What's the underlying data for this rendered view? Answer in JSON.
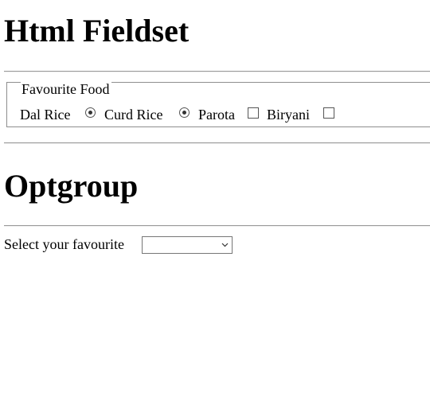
{
  "section_fieldset": {
    "heading": "Html Fieldset",
    "legend": "Favourite Food",
    "options": [
      {
        "label": "Dal Rice",
        "control": "radio",
        "checked": true
      },
      {
        "label": "Curd Rice",
        "control": "radio",
        "checked": true
      },
      {
        "label": "Parota",
        "control": "checkbox",
        "checked": false
      },
      {
        "label": "Biryani",
        "control": "checkbox",
        "checked": false
      }
    ]
  },
  "section_optgroup": {
    "heading": "Optgroup",
    "select_label": "Select your favourite",
    "select_value": ""
  },
  "icons": {
    "radio": "radio-button-icon",
    "checkbox": "checkbox-icon",
    "dropdown": "chevron-down-icon"
  }
}
